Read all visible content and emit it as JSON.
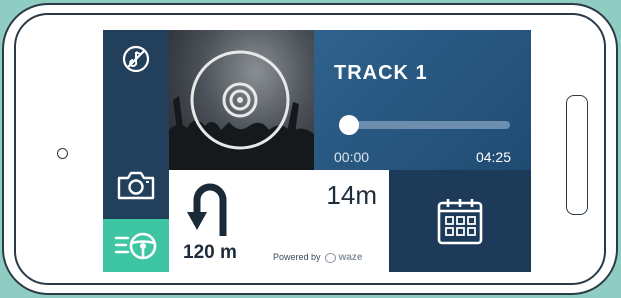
{
  "colors": {
    "background": "#8fcdc3",
    "sidebar": "#223f5c",
    "accent_green": "#3ec5a4",
    "track_panel": "#2f628d",
    "calendar_tile": "#1d3b59"
  },
  "sidebar": {
    "items": [
      {
        "icon": "mute-icon"
      },
      {
        "icon": "camera-icon"
      },
      {
        "icon": "drive-mode-icon",
        "active": true
      }
    ]
  },
  "media": {
    "album_icon": "disc-icon",
    "title": "TRACK 1",
    "progress": 0.05,
    "time_elapsed": "00:00",
    "time_total": "04:25"
  },
  "navigation": {
    "turn_icon": "u-turn-icon",
    "distance_main": "14m",
    "distance_next": "120 m",
    "powered_by": "Powered by",
    "provider": "waze"
  },
  "calendar": {
    "icon": "calendar-icon"
  }
}
